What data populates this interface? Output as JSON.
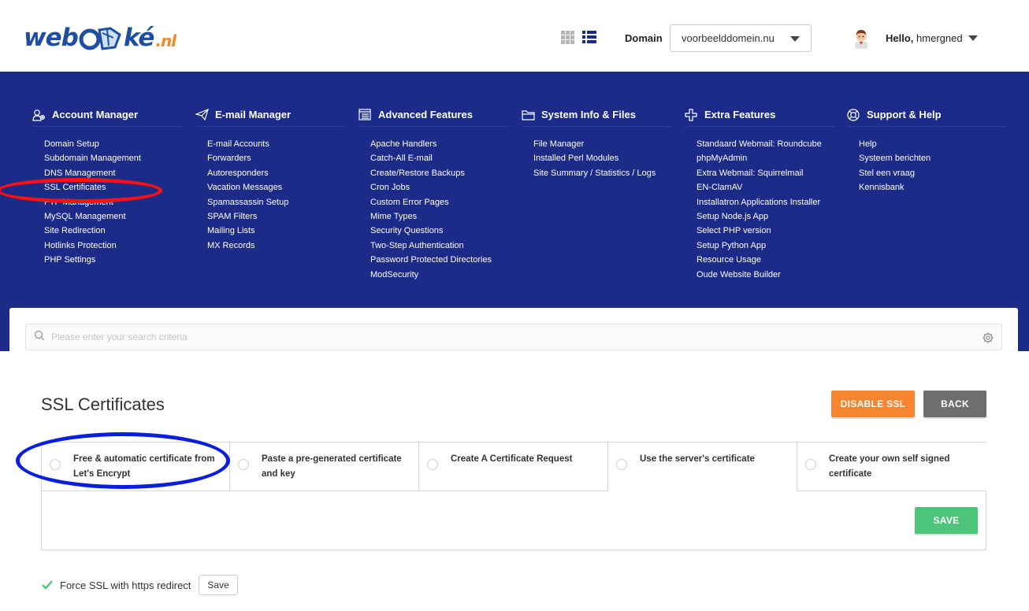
{
  "header": {
    "logo_text_left": "web",
    "logo_text_right": "ké",
    "logo_tld": ".nl",
    "domain_label": "Domain",
    "domain_value": "voorbeelddomein.nu",
    "hello_prefix": "Hello,",
    "hello_user": "hmergned"
  },
  "nav": {
    "columns": [
      {
        "title": "Account Manager",
        "icon": "account-manager-icon",
        "items": [
          "Domain Setup",
          "Subdomain Management",
          "DNS Management",
          "SSL Certificates",
          "FTP Management",
          "MySQL Management",
          "Site Redirection",
          "Hotlinks Protection",
          "PHP Settings"
        ]
      },
      {
        "title": "E-mail Manager",
        "icon": "paper-plane-icon",
        "items": [
          "E-mail Accounts",
          "Forwarders",
          "Autoresponders",
          "Vacation Messages",
          "Spamassassin Setup",
          "SPAM Filters",
          "Mailing Lists",
          "MX Records"
        ]
      },
      {
        "title": "Advanced Features",
        "icon": "list-panel-icon",
        "items": [
          "Apache Handlers",
          "Catch-All E-mail",
          "Create/Restore Backups",
          "Cron Jobs",
          "Custom Error Pages",
          "Mime Types",
          "Security Questions",
          "Two-Step Authentication",
          "Password Protected Directories",
          "ModSecurity"
        ]
      },
      {
        "title": "System Info & Files",
        "icon": "folder-icon",
        "items": [
          "File Manager",
          "Installed Perl Modules",
          "Site Summary / Statistics / Logs"
        ]
      },
      {
        "title": "Extra Features",
        "icon": "plus-cross-icon",
        "items": [
          "Standaard Webmail: Roundcube",
          "phpMyAdmin",
          "Extra Webmail: Squirrelmail",
          "EN-ClamAV",
          "Installatron Applications Installer",
          "Setup Node.js App",
          "Select PHP version",
          "Setup Python App",
          "Resource Usage",
          "Oude Website Builder"
        ]
      },
      {
        "title": "Support & Help",
        "icon": "lifebuoy-icon",
        "items": [
          "Help",
          "Systeem berichten",
          "Stel een vraag",
          "Kennisbank"
        ]
      }
    ]
  },
  "search": {
    "placeholder": "Please enter your search criteria"
  },
  "page": {
    "title": "SSL Certificates",
    "disable_ssl_label": "DISABLE SSL",
    "back_label": "BACK",
    "save_label": "SAVE",
    "tabs": [
      {
        "label": "Free & automatic certificate from Let's Encrypt"
      },
      {
        "label": "Paste a pre-generated certificate and key"
      },
      {
        "label": "Create A Certificate Request"
      },
      {
        "label": "Use the server's certificate"
      },
      {
        "label": "Create your own self signed certificate"
      }
    ],
    "force_ssl_label": "Force SSL with https redirect",
    "force_ssl_checked": true,
    "force_save_label": "Save"
  },
  "colors": {
    "nav_background": "#1b2b87",
    "disable_button": "#f7852f",
    "back_button": "#6e6e6e",
    "save_button": "#4cc57a",
    "logo_blue": "#1f4fa3",
    "annotation_red": "#ff1010",
    "annotation_blue": "#0a1ee0"
  }
}
